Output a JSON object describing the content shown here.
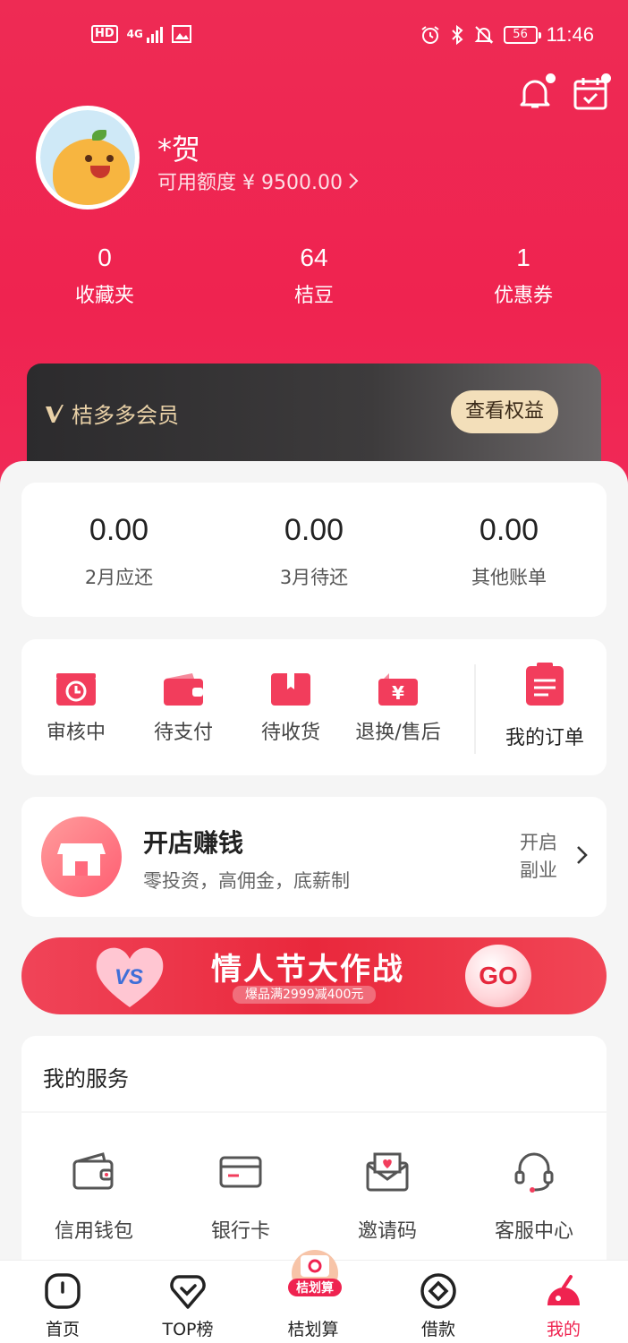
{
  "status_bar": {
    "hd": "HD",
    "network": "4G",
    "battery": "56",
    "time": "11:46"
  },
  "profile": {
    "name": "*贺",
    "credit_label": "可用额度 ¥ 9500.00"
  },
  "stats": [
    {
      "value": "0",
      "label": "收藏夹"
    },
    {
      "value": "64",
      "label": "桔豆"
    },
    {
      "value": "1",
      "label": "优惠券"
    }
  ],
  "vip": {
    "title": "桔多多会员",
    "button": "查看权益"
  },
  "bills": [
    {
      "value": "0.00",
      "label": "2月应还"
    },
    {
      "value": "0.00",
      "label": "3月待还"
    },
    {
      "value": "0.00",
      "label": "其他账单"
    }
  ],
  "orders": {
    "items": [
      {
        "label": "审核中",
        "icon": "clock-icon"
      },
      {
        "label": "待支付",
        "icon": "wallet-icon"
      },
      {
        "label": "待收货",
        "icon": "box-icon"
      },
      {
        "label": "退换/售后",
        "icon": "refund-icon"
      }
    ],
    "all_label": "我的订单"
  },
  "shop": {
    "title": "开店赚钱",
    "subtitle": "零投资，高佣金，底薪制",
    "action_line1": "开启",
    "action_line2": "副业"
  },
  "banner": {
    "vs": "VS",
    "title": "情人节大作战",
    "subtitle": "爆品满2999减400元",
    "go": "GO"
  },
  "services": {
    "title": "我的服务",
    "items": [
      {
        "label": "信用钱包",
        "icon": "wallet-icon"
      },
      {
        "label": "银行卡",
        "icon": "bank-card-icon"
      },
      {
        "label": "邀请码",
        "icon": "invite-envelope-icon"
      },
      {
        "label": "客服中心",
        "icon": "headset-icon"
      }
    ]
  },
  "tabbar": {
    "items": [
      {
        "label": "首页"
      },
      {
        "label": "TOP榜"
      },
      {
        "label": "桔划算",
        "badge": "桔划算"
      },
      {
        "label": "借款"
      },
      {
        "label": "我的"
      }
    ],
    "active": "我的"
  },
  "colors": {
    "primary": "#ef2350",
    "gold": "#f3dfba",
    "vip_bg": "#2c2b2d"
  }
}
